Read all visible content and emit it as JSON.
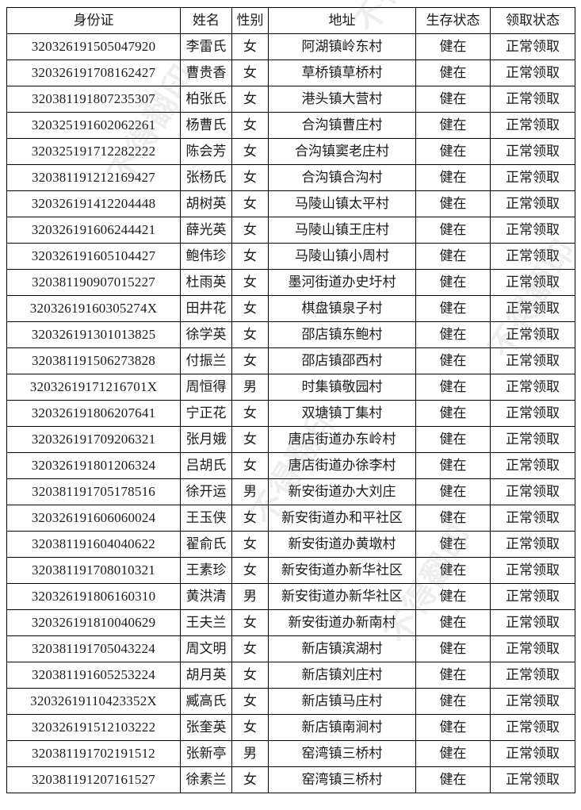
{
  "table": {
    "headers": {
      "id": "身份证",
      "name": "姓名",
      "gender": "性别",
      "address": "地址",
      "alive_status": "生存状态",
      "claim_status": "领取状态"
    },
    "rows": [
      {
        "id": "320326191505047920",
        "name": "李雷氏",
        "gender": "女",
        "address": "阿湖镇岭东村",
        "alive": "健在",
        "claim": "正常领取"
      },
      {
        "id": "320326191708162427",
        "name": "曹贵香",
        "gender": "女",
        "address": "草桥镇草桥村",
        "alive": "健在",
        "claim": "正常领取"
      },
      {
        "id": "320381191807235307",
        "name": "柏张氏",
        "gender": "女",
        "address": "港头镇大营村",
        "alive": "健在",
        "claim": "正常领取"
      },
      {
        "id": "320325191602062261",
        "name": "杨曹氏",
        "gender": "女",
        "address": "合沟镇曹庄村",
        "alive": "健在",
        "claim": "正常领取"
      },
      {
        "id": "320325191712282222",
        "name": "陈会芳",
        "gender": "女",
        "address": "合沟镇窦老庄村",
        "alive": "健在",
        "claim": "正常领取"
      },
      {
        "id": "320381191212169427",
        "name": "张杨氏",
        "gender": "女",
        "address": "合沟镇合沟村",
        "alive": "健在",
        "claim": "正常领取"
      },
      {
        "id": "320326191412204448",
        "name": "胡树英",
        "gender": "女",
        "address": "马陵山镇太平村",
        "alive": "健在",
        "claim": "正常领取"
      },
      {
        "id": "320326191606244421",
        "name": "薛光英",
        "gender": "女",
        "address": "马陵山镇王庄村",
        "alive": "健在",
        "claim": "正常领取"
      },
      {
        "id": "320326191605104427",
        "name": "鲍伟珍",
        "gender": "女",
        "address": "马陵山镇小周村",
        "alive": "健在",
        "claim": "正常领取"
      },
      {
        "id": "320381190907015227",
        "name": "杜雨英",
        "gender": "女",
        "address": "墨河街道办史圩村",
        "alive": "健在",
        "claim": "正常领取"
      },
      {
        "id": "32032619160305274X",
        "name": "田井花",
        "gender": "女",
        "address": "棋盘镇泉子村",
        "alive": "健在",
        "claim": "正常领取"
      },
      {
        "id": "320326191301013825",
        "name": "徐学英",
        "gender": "女",
        "address": "邵店镇东鲍村",
        "alive": "健在",
        "claim": "正常领取"
      },
      {
        "id": "320381191506273828",
        "name": "付振兰",
        "gender": "女",
        "address": "邵店镇邵西村",
        "alive": "健在",
        "claim": "正常领取"
      },
      {
        "id": "32032619171216701X",
        "name": "周恒得",
        "gender": "男",
        "address": "时集镇敬园村",
        "alive": "健在",
        "claim": "正常领取"
      },
      {
        "id": "320326191806207641",
        "name": "宁正花",
        "gender": "女",
        "address": "双塘镇丁集村",
        "alive": "健在",
        "claim": "正常领取"
      },
      {
        "id": "320326191709206321",
        "name": "张月娥",
        "gender": "女",
        "address": "唐店街道办东岭村",
        "alive": "健在",
        "claim": "正常领取"
      },
      {
        "id": "320326191801206324",
        "name": "吕胡氏",
        "gender": "女",
        "address": "唐店街道办徐李村",
        "alive": "健在",
        "claim": "正常领取"
      },
      {
        "id": "320381191705178516",
        "name": "徐开运",
        "gender": "男",
        "address": "新安街道办大刘庄",
        "alive": "健在",
        "claim": "正常领取"
      },
      {
        "id": "320326191606060024",
        "name": "王玉侠",
        "gender": "女",
        "address": "新安街道办和平社区",
        "alive": "健在",
        "claim": "正常领取"
      },
      {
        "id": "320381191604040622",
        "name": "翟俞氏",
        "gender": "女",
        "address": "新安街道办黄墩村",
        "alive": "健在",
        "claim": "正常领取"
      },
      {
        "id": "320381191708010321",
        "name": "王素珍",
        "gender": "女",
        "address": "新安街道办新华社区",
        "alive": "健在",
        "claim": "正常领取"
      },
      {
        "id": "320326191806160310",
        "name": "黄洪清",
        "gender": "男",
        "address": "新安街道办新华社区",
        "alive": "健在",
        "claim": "正常领取"
      },
      {
        "id": "320326191810040629",
        "name": "王夫兰",
        "gender": "女",
        "address": "新安街道办新南村",
        "alive": "健在",
        "claim": "正常领取"
      },
      {
        "id": "320381191705043224",
        "name": "周文明",
        "gender": "女",
        "address": "新店镇滨湖村",
        "alive": "健在",
        "claim": "正常领取"
      },
      {
        "id": "320381191605253224",
        "name": "胡月英",
        "gender": "女",
        "address": "新店镇刘庄村",
        "alive": "健在",
        "claim": "正常领取"
      },
      {
        "id": "32032619110423352X",
        "name": "臧高氏",
        "gender": "女",
        "address": "新店镇马庄村",
        "alive": "健在",
        "claim": "正常领取"
      },
      {
        "id": "320326191512103222",
        "name": "张奎英",
        "gender": "女",
        "address": "新店镇南涧村",
        "alive": "健在",
        "claim": "正常领取"
      },
      {
        "id": "320381191702191512",
        "name": "张新亭",
        "gender": "男",
        "address": "窑湾镇三桥村",
        "alive": "健在",
        "claim": "正常领取"
      },
      {
        "id": "320381191207161527",
        "name": "徐素兰",
        "gender": "女",
        "address": "窑湾镇三桥村",
        "alive": "健在",
        "claim": "正常领取"
      }
    ]
  },
  "watermark": {
    "text": "不得翻印"
  }
}
